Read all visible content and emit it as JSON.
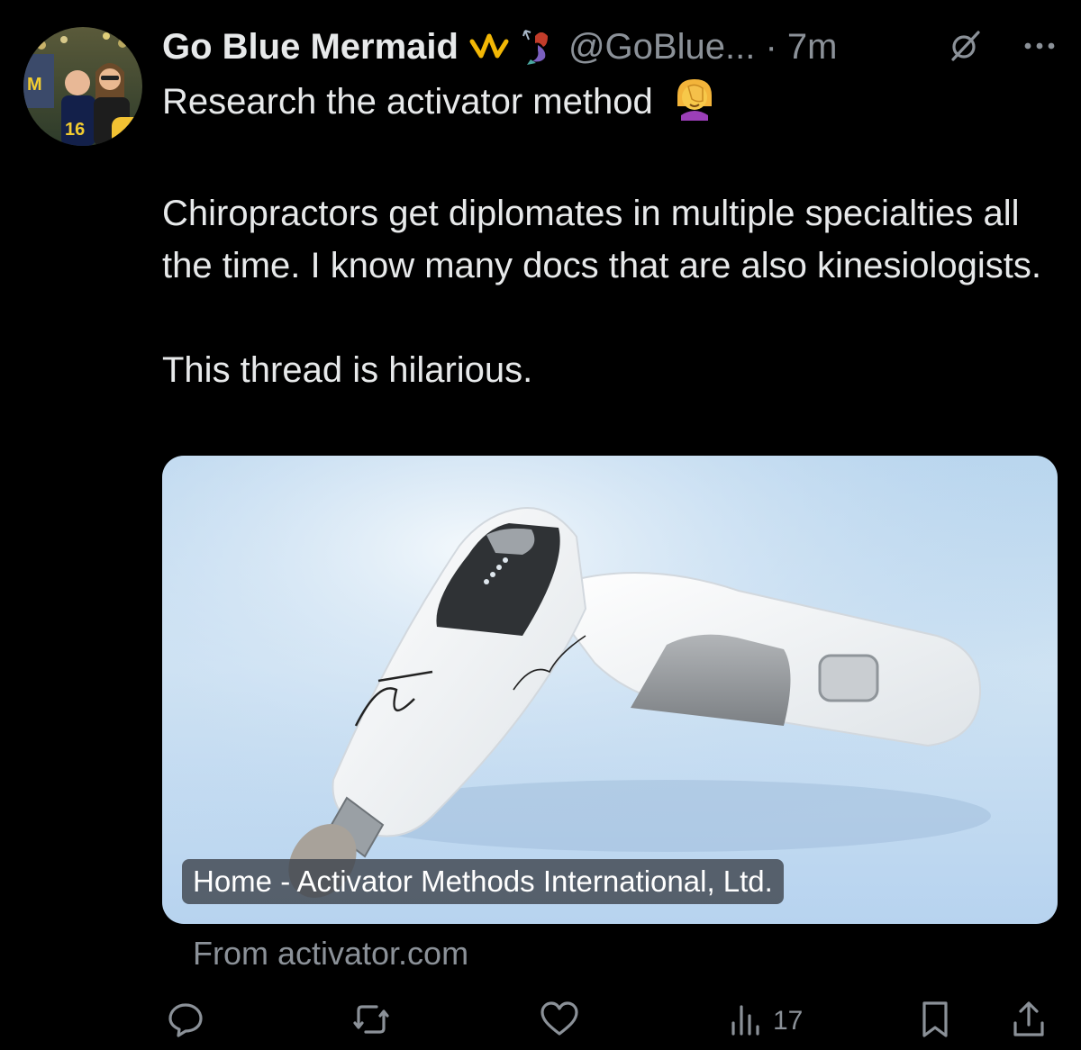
{
  "author": {
    "name": "Go Blue Mermaid",
    "handle": "@GoBlue...",
    "separator": "·",
    "time": "7m"
  },
  "tweet": {
    "lines": [
      "Research the activator method",
      "",
      "Chiropractors get diplomates in multiple specialties all the time. I know many docs that are also kinesiologists.",
      "",
      "This thread is hilarious."
    ]
  },
  "card": {
    "title": "Home - Activator Methods International, Ltd.",
    "source": "From activator.com"
  },
  "actions": {
    "views_count": "17"
  },
  "colors": {
    "background": "#000000",
    "text": "#e7e9ea",
    "muted": "#8b9198",
    "crown": "#f2b705"
  }
}
